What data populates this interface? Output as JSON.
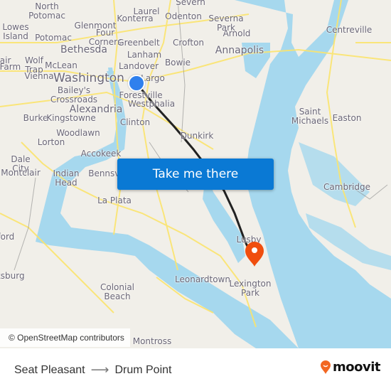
{
  "map": {
    "colors": {
      "land": "#f1efe9",
      "water": "#a6d8ee",
      "road": "#fbe46d",
      "route_line": "#222222",
      "origin_dot": "#2f80ed",
      "destination_pin": "#f04e0e"
    },
    "labels": [
      {
        "text": "North Potomac"
      },
      {
        "text": "Laurel"
      },
      {
        "text": "Konterra"
      },
      {
        "text": "Odenton"
      },
      {
        "text": "Severn"
      },
      {
        "text": "Lowes Island"
      },
      {
        "text": "Glenmont"
      },
      {
        "text": "Four Corners"
      },
      {
        "text": "Potomac"
      },
      {
        "text": "Greenbelt"
      },
      {
        "text": "Crofton"
      },
      {
        "text": "Bethesda"
      },
      {
        "text": "Lanham"
      },
      {
        "text": "Wolf Trap"
      },
      {
        "text": "McLean"
      },
      {
        "text": "Landover"
      },
      {
        "text": "Bowie"
      },
      {
        "text": "Vienna"
      },
      {
        "text": "Washington"
      },
      {
        "text": "Largo"
      },
      {
        "text": "Bailey's Crossroads"
      },
      {
        "text": "Forestville"
      },
      {
        "text": "Westphalia"
      },
      {
        "text": "Alexandria"
      },
      {
        "text": "Burke"
      },
      {
        "text": "Kingstowne"
      },
      {
        "text": "Clinton"
      },
      {
        "text": "Woodlawn"
      },
      {
        "text": "Lorton"
      },
      {
        "text": "Dunkirk"
      },
      {
        "text": "Accokeek"
      },
      {
        "text": "Dale City"
      },
      {
        "text": "Montclair"
      },
      {
        "text": "Indian Head"
      },
      {
        "text": "Bennsville"
      },
      {
        "text": "La Plata"
      },
      {
        "text": "Severna Park"
      },
      {
        "text": "Arnold"
      },
      {
        "text": "Annapolis"
      },
      {
        "text": "Centreville"
      },
      {
        "text": "Saint Michaels"
      },
      {
        "text": "Easton"
      },
      {
        "text": "Cambridge"
      },
      {
        "text": "Lusby"
      },
      {
        "text": "Leonardtown"
      },
      {
        "text": "Lexington Park"
      },
      {
        "text": "Colonial Beach"
      },
      {
        "text": "Montross"
      },
      {
        "text": "Stafford"
      },
      {
        "text": "Fredericksburg"
      },
      {
        "text": "Nair"
      },
      {
        "text": "Franklin Farm"
      },
      {
        "text": "Centreville"
      }
    ],
    "attribution": "© OpenStreetMap contributors"
  },
  "cta": {
    "label": "Take me there"
  },
  "route": {
    "origin": "Seat Pleasant",
    "destination": "Drum Point",
    "arrow": "⟶"
  },
  "brand": {
    "name": "moovit",
    "color": "#f26722"
  }
}
